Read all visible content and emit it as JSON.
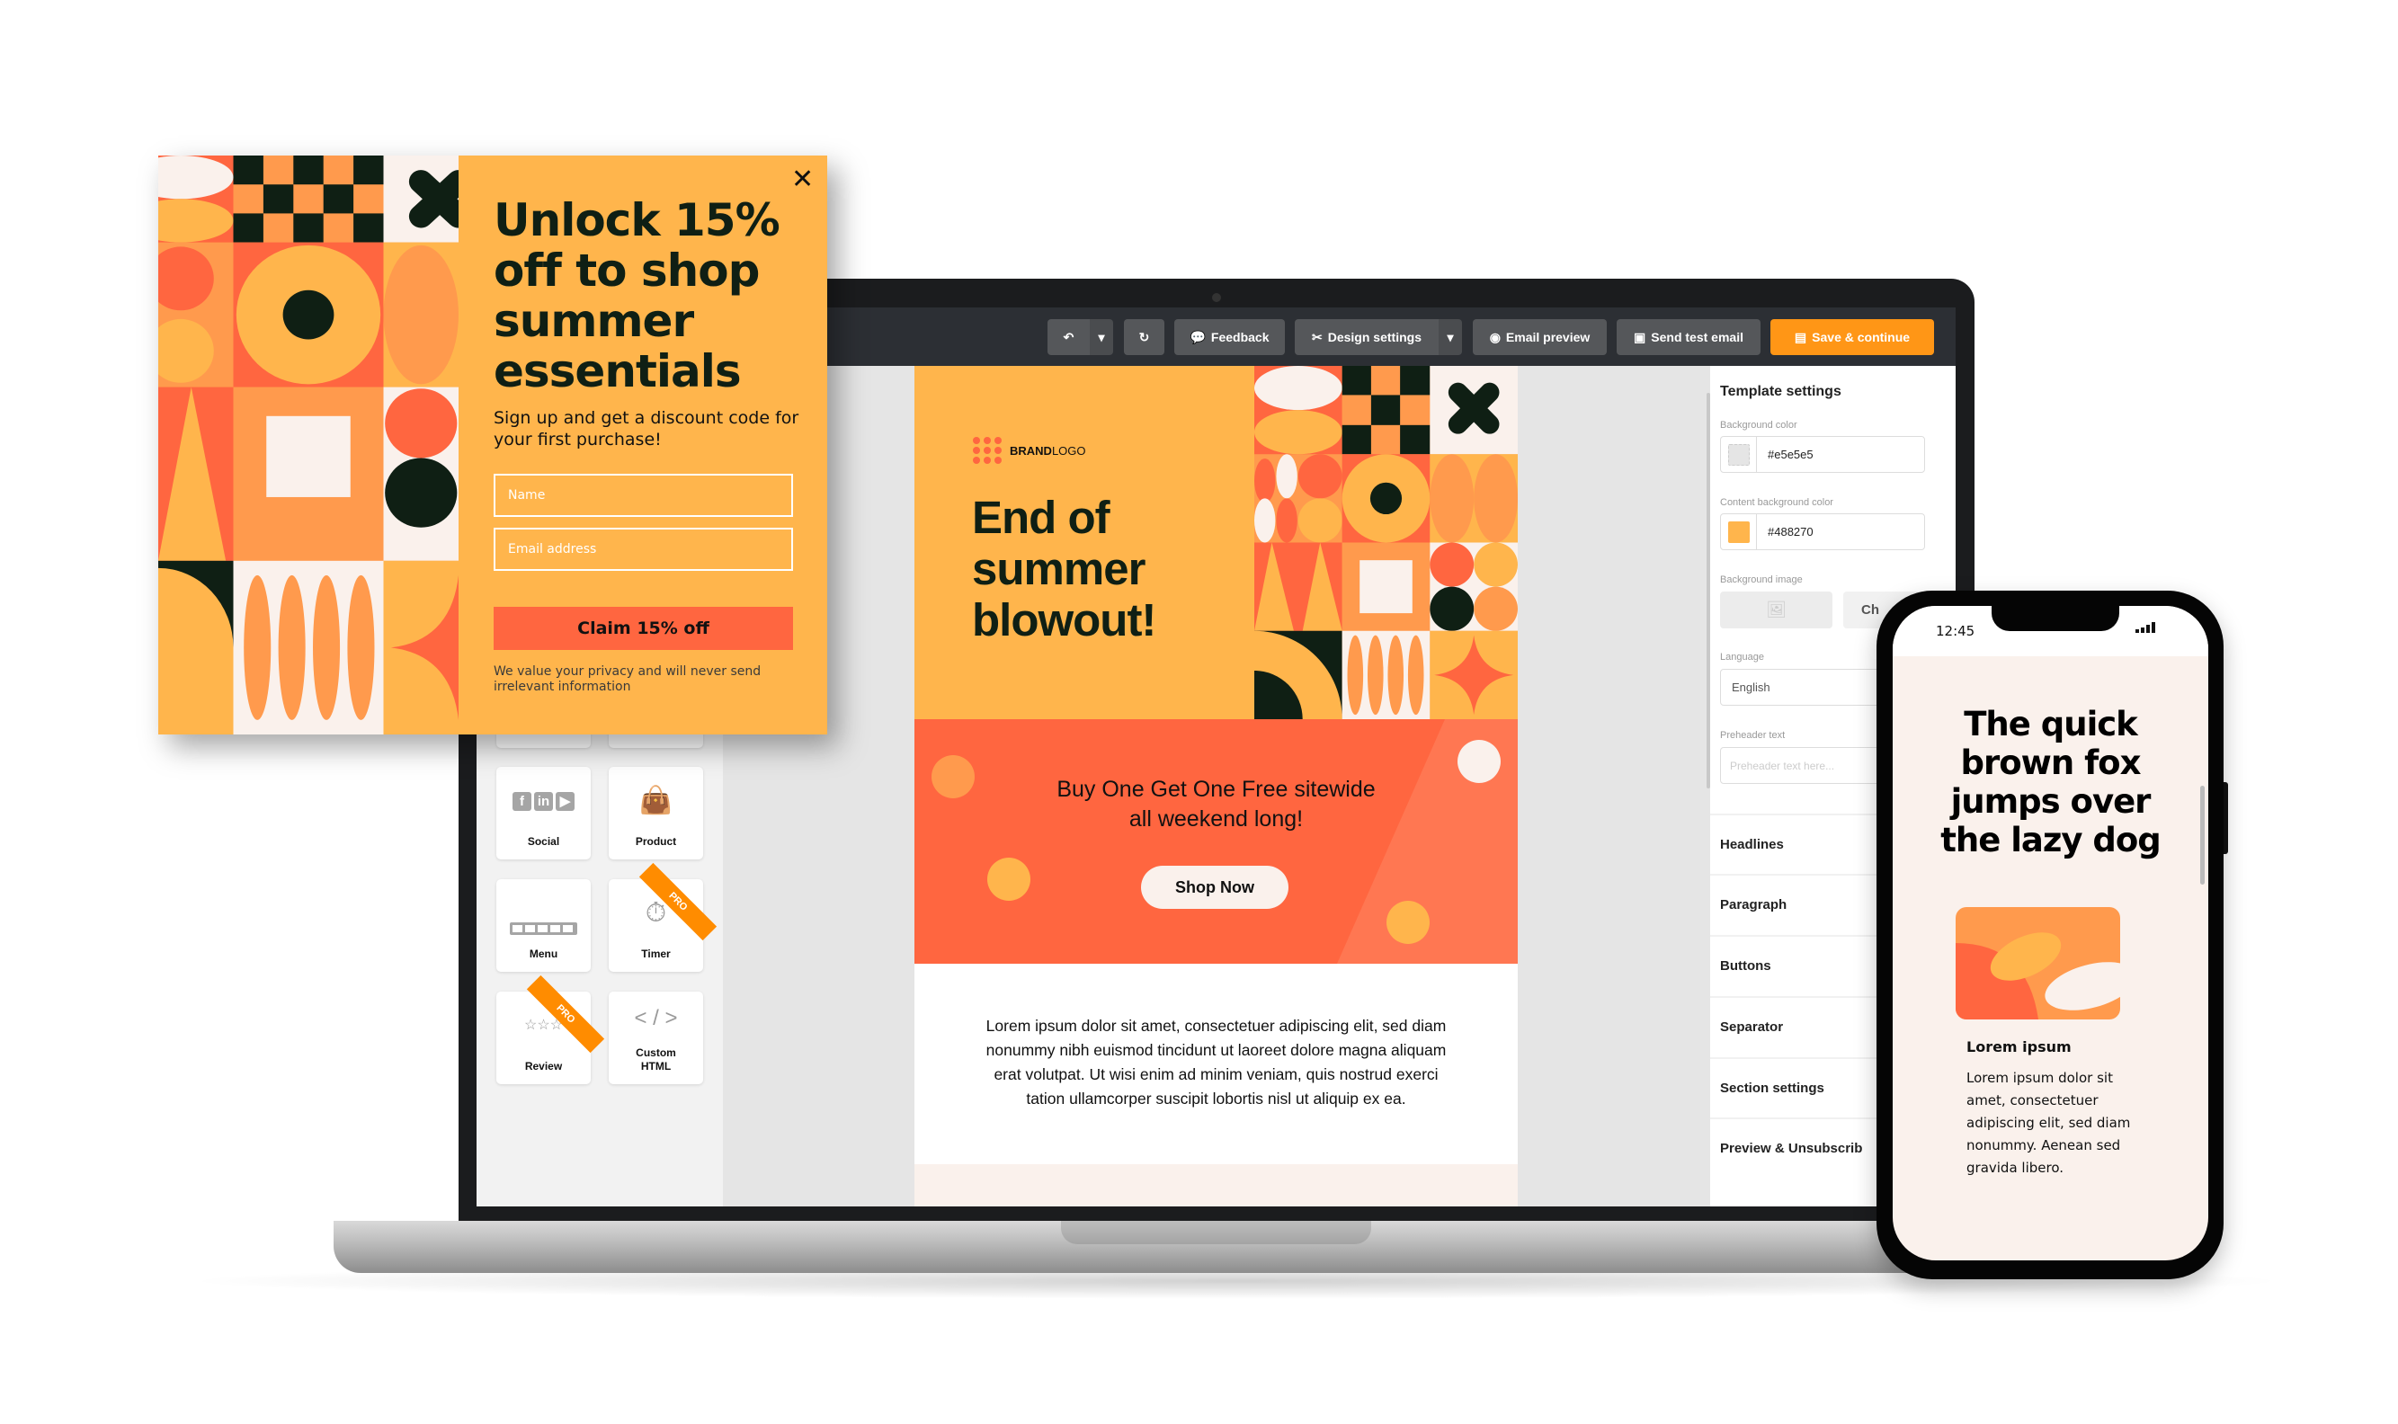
{
  "toolbar": {
    "undo_icon": "undo-icon",
    "redo_icon": "redo-icon",
    "feedback": "Feedback",
    "design_settings": "Design settings",
    "email_preview": "Email preview",
    "send_test_email": "Send test email",
    "save_continue": "Save & continue",
    "accent_color": "#ff9616"
  },
  "blocks": [
    {
      "label": "Social",
      "icon": "social-icons"
    },
    {
      "label": "Product",
      "icon": "shopping-bag-icon"
    },
    {
      "label": "Menu",
      "icon": "menu-bar-icon"
    },
    {
      "label": "Timer",
      "icon": "stopwatch-icon",
      "badge": "PRO"
    },
    {
      "label": "Review",
      "icon": "star-rating-icon",
      "badge": "PRO"
    },
    {
      "label": "Custom HTML",
      "icon": "code-icon"
    }
  ],
  "email": {
    "logo_bold": "BRAND",
    "logo_light": "LOGO",
    "hero_title": [
      "End of",
      "summer",
      "blowout!"
    ],
    "promo_line1": "Buy One Get One Free sitewide",
    "promo_line2": "all weekend long!",
    "cta": "Shop Now",
    "paragraph": "Lorem ipsum dolor sit amet, consectetuer adipiscing elit, sed diam nonummy nibh euismod tincidunt ut laoreet dolore magna aliquam erat volutpat. Ut wisi enim ad minim veniam, quis nostrud exerci tation ullamcorper suscipit lobortis nisl ut aliquip ex ea."
  },
  "settings": {
    "title": "Template settings",
    "background_color_label": "Background color",
    "background_color": "#e5e5e5",
    "content_background_label": "Content background color",
    "content_background": "#488270",
    "content_swatch": "#ffb54c",
    "background_image_label": "Background image",
    "background_image_button": "Ch",
    "language_label": "Language",
    "language": "English",
    "preheader_label": "Preheader text",
    "preheader_placeholder": "Preheader text here...",
    "sections": [
      "Headlines",
      "Paragraph",
      "Buttons",
      "Separator",
      "Section settings",
      "Preview & Unsubscrib"
    ]
  },
  "popup": {
    "title": [
      "Unlock 15%",
      "off to shop",
      "summer",
      "essentials"
    ],
    "subtitle": "Sign up and get a discount code for your first purchase!",
    "name_placeholder": "Name",
    "email_placeholder": "Email address",
    "claim": "Claim 15% off",
    "privacy": "We value your privacy and will never send irrelevant information",
    "close_icon": "close-icon"
  },
  "phone": {
    "time": "12:45",
    "title": [
      "The quick",
      "brown fox",
      "jumps over",
      "the lazy dog"
    ],
    "heading": "Lorem ipsum",
    "paragraph": "Lorem ipsum dolor sit amet, consectetuer adipiscing elit, sed diam nonummy. Aenean sed gravida libero."
  },
  "colors": {
    "orange": "#ffb54c",
    "coral": "#ff6640",
    "mid_orange": "#ff9a4d",
    "dark": "#0f1f14",
    "cream": "#faf1ec"
  }
}
